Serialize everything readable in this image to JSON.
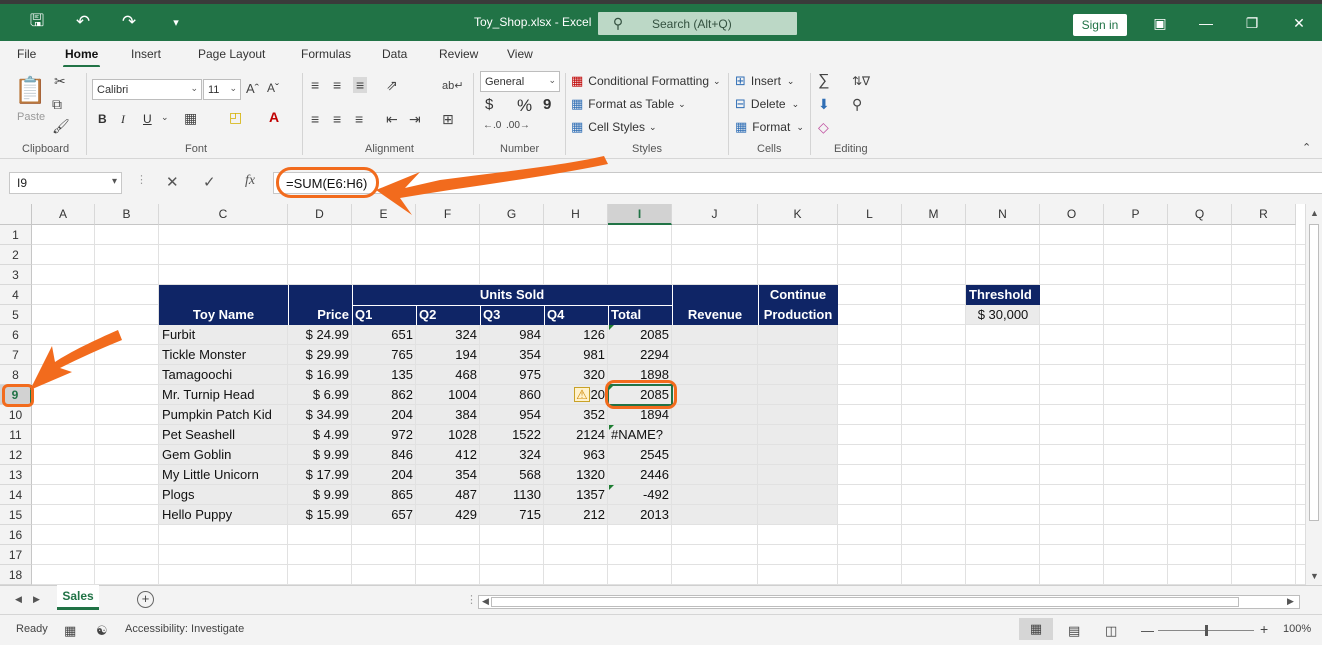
{
  "app": {
    "title": "Toy_Shop.xlsx - Excel",
    "search_placeholder": "Search (Alt+Q)",
    "sign_in": "Sign in"
  },
  "menu_tabs": [
    "File",
    "Home",
    "Insert",
    "Page Layout",
    "Formulas",
    "Data",
    "Review",
    "View"
  ],
  "active_tab": "Home",
  "ribbon": {
    "clipboard": {
      "label": "Clipboard",
      "paste": "Paste"
    },
    "font": {
      "label": "Font",
      "font_name": "Calibri",
      "font_size": "11",
      "bold": "B",
      "italic": "I",
      "underline": "U"
    },
    "alignment": {
      "label": "Alignment"
    },
    "number": {
      "label": "Number",
      "format": "General",
      "currency": "$",
      "percent": "%",
      "comma": "9"
    },
    "styles": {
      "label": "Styles",
      "conditional_formatting": "Conditional Formatting",
      "format_as_table": "Format as Table",
      "cell_styles": "Cell Styles"
    },
    "cells": {
      "label": "Cells",
      "insert": "Insert",
      "delete": "Delete",
      "format": "Format"
    },
    "editing": {
      "label": "Editing"
    }
  },
  "formula_bar": {
    "name_box": "I9",
    "fx": "fx",
    "formula": "=SUM(E6:H6)"
  },
  "columns": [
    "A",
    "B",
    "C",
    "D",
    "E",
    "F",
    "G",
    "H",
    "I",
    "J",
    "K",
    "L",
    "M",
    "N",
    "O",
    "P",
    "Q",
    "R"
  ],
  "rows": [
    "1",
    "2",
    "3",
    "4",
    "5",
    "6",
    "7",
    "8",
    "9",
    "10",
    "11",
    "12",
    "13",
    "14",
    "15",
    "16",
    "17",
    "18"
  ],
  "selected_cell": {
    "column": "I",
    "row": "9"
  },
  "sheet": {
    "header_units_sold": "Units Sold",
    "header_toy_name": "Toy Name",
    "header_price": "Price",
    "header_q1": "Q1",
    "header_q2": "Q2",
    "header_q3": "Q3",
    "header_q4": "Q4",
    "header_total": "Total",
    "header_revenue": "Revenue",
    "header_continue_1": "Continue",
    "header_continue_2": "Production",
    "threshold_label": "Threshold",
    "threshold_value": "$ 30,000",
    "data_rows": [
      {
        "name": "Furbit",
        "price": "$ 24.99",
        "q1": "651",
        "q2": "324",
        "q3": "984",
        "q4": "126",
        "total": "2085"
      },
      {
        "name": "Tickle Monster",
        "price": "$ 29.99",
        "q1": "765",
        "q2": "194",
        "q3": "354",
        "q4": "981",
        "total": "2294"
      },
      {
        "name": "Tamagoochi",
        "price": "$ 16.99",
        "q1": "135",
        "q2": "468",
        "q3": "975",
        "q4": "320",
        "total": "1898"
      },
      {
        "name": "Mr. Turnip Head",
        "price": "$ 6.99",
        "q1": "862",
        "q2": "1004",
        "q3": "860",
        "q4": "20",
        "total": "2085"
      },
      {
        "name": "Pumpkin Patch Kid",
        "price": "$ 34.99",
        "q1": "204",
        "q2": "384",
        "q3": "954",
        "q4": "352",
        "total": "1894"
      },
      {
        "name": "Pet Seashell",
        "price": "$ 4.99",
        "q1": "972",
        "q2": "1028",
        "q3": "1522",
        "q4": "2124",
        "total": "#NAME?"
      },
      {
        "name": "Gem Goblin",
        "price": "$ 9.99",
        "q1": "846",
        "q2": "412",
        "q3": "324",
        "q4": "963",
        "total": "2545"
      },
      {
        "name": "My Little Unicorn",
        "price": "$ 17.99",
        "q1": "204",
        "q2": "354",
        "q3": "568",
        "q4": "1320",
        "total": "2446"
      },
      {
        "name": "Plogs",
        "price": "$ 9.99",
        "q1": "865",
        "q2": "487",
        "q3": "1130",
        "q4": "1357",
        "total": "-492"
      },
      {
        "name": "Hello Puppy",
        "price": "$ 15.99",
        "q1": "657",
        "q2": "429",
        "q3": "715",
        "q4": "212",
        "total": "2013"
      }
    ]
  },
  "sheet_tabs": [
    "Sales"
  ],
  "status": {
    "ready": "Ready",
    "accessibility": "Accessibility: Investigate",
    "zoom": "100%"
  },
  "colors": {
    "excel_green": "#217346",
    "header_navy": "#0f2566",
    "annotation_orange": "#f26b1d",
    "band_grey": "#ebebeb"
  }
}
